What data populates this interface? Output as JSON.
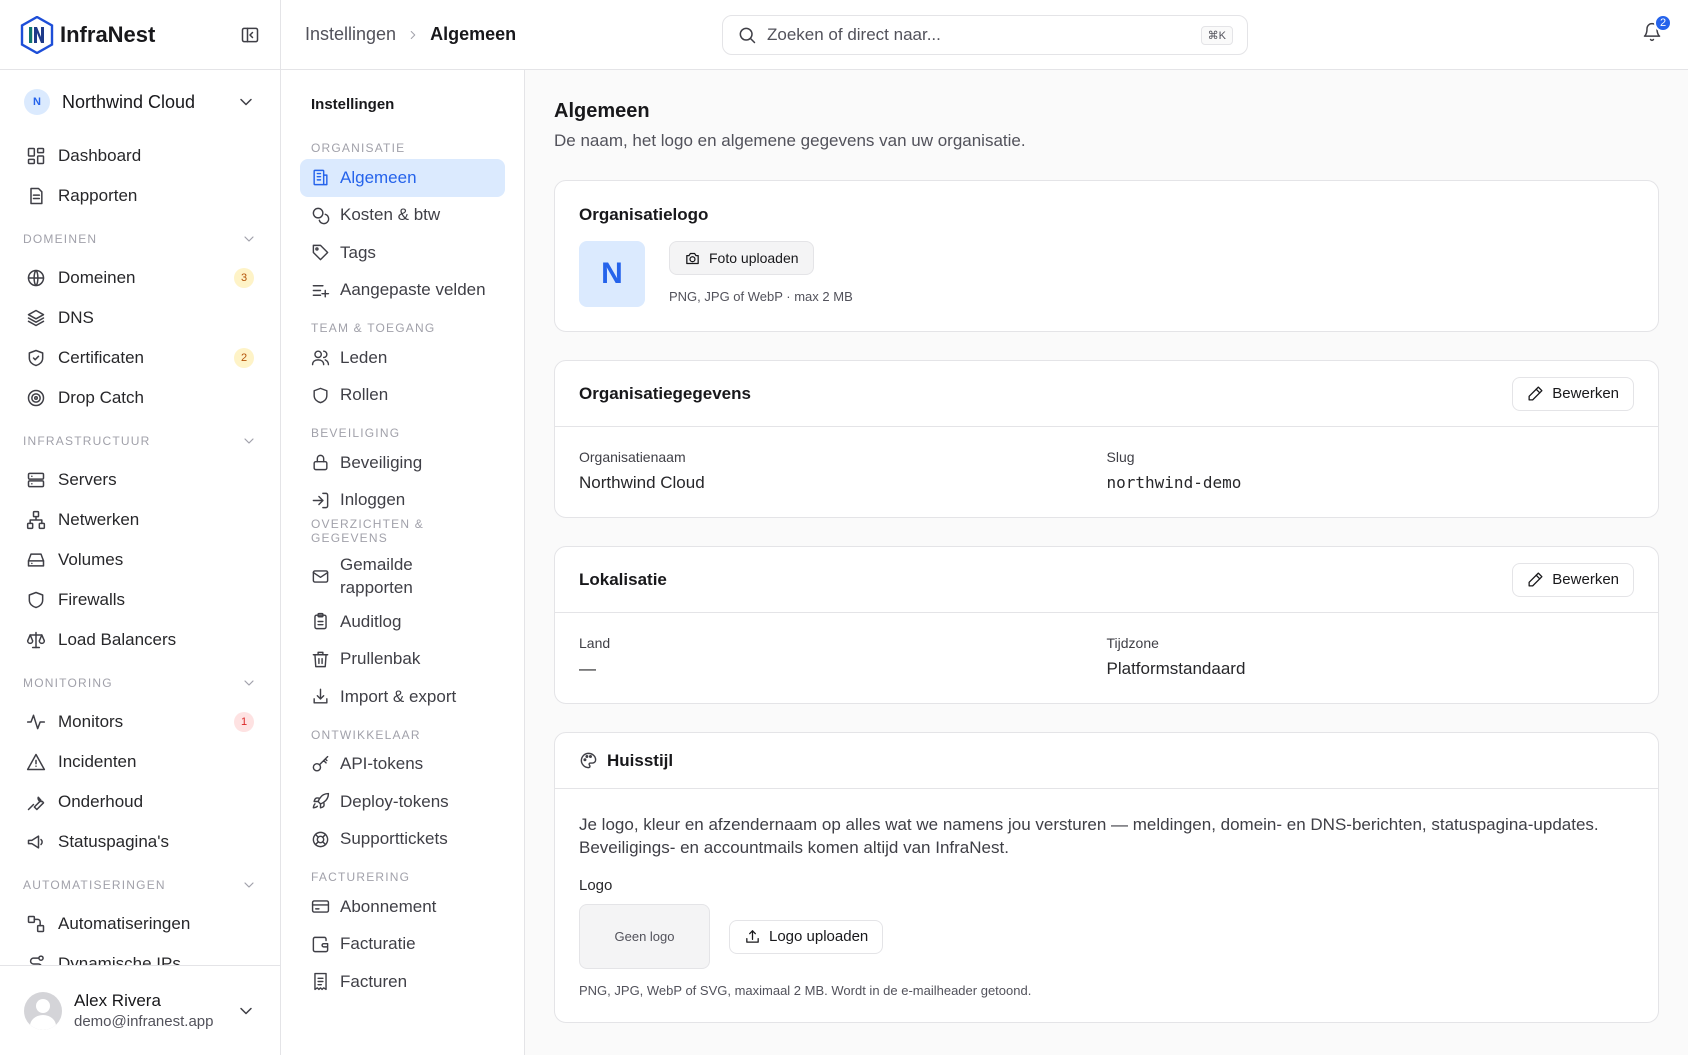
{
  "app": {
    "name": "InfraNest"
  },
  "org": {
    "initial": "N",
    "name": "Northwind Cloud"
  },
  "sidebar": {
    "top": [
      {
        "label": "Dashboard",
        "icon": "dashboard-icon"
      },
      {
        "label": "Rapporten",
        "icon": "report-icon"
      }
    ],
    "sections": [
      {
        "title": "DOMEINEN",
        "items": [
          {
            "label": "Domeinen",
            "icon": "globe-icon",
            "badge": "3",
            "badge_color": "amber"
          },
          {
            "label": "DNS",
            "icon": "layers-icon"
          },
          {
            "label": "Certificaten",
            "icon": "shield-check-icon",
            "badge": "2",
            "badge_color": "amber"
          },
          {
            "label": "Drop Catch",
            "icon": "target-icon"
          }
        ]
      },
      {
        "title": "INFRASTRUCTUUR",
        "items": [
          {
            "label": "Servers",
            "icon": "server-icon"
          },
          {
            "label": "Netwerken",
            "icon": "network-icon"
          },
          {
            "label": "Volumes",
            "icon": "drive-icon"
          },
          {
            "label": "Firewalls",
            "icon": "shield-icon"
          },
          {
            "label": "Load Balancers",
            "icon": "scale-icon"
          }
        ]
      },
      {
        "title": "MONITORING",
        "items": [
          {
            "label": "Monitors",
            "icon": "activity-icon",
            "badge": "1",
            "badge_color": "red"
          },
          {
            "label": "Incidenten",
            "icon": "alert-icon"
          },
          {
            "label": "Onderhoud",
            "icon": "wrench-icon"
          },
          {
            "label": "Statuspagina's",
            "icon": "megaphone-icon"
          }
        ]
      },
      {
        "title": "AUTOMATISERINGEN",
        "items": [
          {
            "label": "Automatiseringen",
            "icon": "workflow-icon"
          },
          {
            "label": "Dynamische IPs",
            "icon": "route-icon"
          }
        ]
      }
    ]
  },
  "user": {
    "name": "Alex Rivera",
    "email": "demo@infranest.app"
  },
  "topbar": {
    "breadcrumb": [
      "Instellingen",
      "Algemeen"
    ],
    "search_placeholder": "Zoeken of direct naar...",
    "shortcut": "⌘K",
    "notifications": "2"
  },
  "subnav": {
    "heading": "Instellingen",
    "sections": [
      {
        "title": "ORGANISATIE",
        "items": [
          {
            "label": "Algemeen",
            "icon": "building-icon",
            "active": true
          },
          {
            "label": "Kosten & btw",
            "icon": "coins-icon"
          },
          {
            "label": "Tags",
            "icon": "tag-icon"
          },
          {
            "label": "Aangepaste velden",
            "icon": "list-plus-icon"
          }
        ]
      },
      {
        "title": "TEAM & TOEGANG",
        "items": [
          {
            "label": "Leden",
            "icon": "users-icon"
          },
          {
            "label": "Rollen",
            "icon": "shield-icon"
          }
        ]
      },
      {
        "title": "BEVEILIGING",
        "items": [
          {
            "label": "Beveiliging",
            "icon": "lock-icon"
          },
          {
            "label": "Inloggen",
            "icon": "login-icon"
          }
        ]
      },
      {
        "title": "OVERZICHTEN & GEGEVENS",
        "items": [
          {
            "label": "Gemailde\nrapporten",
            "icon": "mail-icon"
          },
          {
            "label": "Auditlog",
            "icon": "clipboard-icon"
          },
          {
            "label": "Prullenbak",
            "icon": "trash-icon"
          },
          {
            "label": "Import & export",
            "icon": "download-icon"
          }
        ]
      },
      {
        "title": "ONTWIKKELAAR",
        "items": [
          {
            "label": "API-tokens",
            "icon": "key-icon"
          },
          {
            "label": "Deploy-tokens",
            "icon": "rocket-icon"
          },
          {
            "label": "Supporttickets",
            "icon": "lifebuoy-icon"
          }
        ]
      },
      {
        "title": "FACTURERING",
        "items": [
          {
            "label": "Abonnement",
            "icon": "credit-card-icon"
          },
          {
            "label": "Facturatie",
            "icon": "wallet-icon"
          },
          {
            "label": "Facturen",
            "icon": "receipt-icon"
          }
        ]
      }
    ]
  },
  "main": {
    "title": "Algemeen",
    "subtitle": "De naam, het logo en algemene gegevens van uw organisatie.",
    "logo_card": {
      "title": "Organisatielogo",
      "initial": "N",
      "upload_label": "Foto uploaden",
      "hint": "PNG, JPG of WebP · max 2 MB"
    },
    "details_card": {
      "title": "Organisatiegegevens",
      "edit_label": "Bewerken",
      "name_label": "Organisatienaam",
      "name_value": "Northwind Cloud",
      "slug_label": "Slug",
      "slug_value": "northwind-demo"
    },
    "locale_card": {
      "title": "Lokalisatie",
      "edit_label": "Bewerken",
      "country_label": "Land",
      "country_value": "—",
      "tz_label": "Tijdzone",
      "tz_value": "Platformstandaard"
    },
    "brand_card": {
      "title": "Huisstijl",
      "description": "Je logo, kleur en afzendernaam op alles wat we namens jou versturen — meldingen, domein- en DNS-berichten, statuspagina-updates. Beveiligings- en accountmails komen altijd van InfraNest.",
      "logo_label": "Logo",
      "no_logo": "Geen logo",
      "upload_label": "Logo uploaden",
      "hint": "PNG, JPG, WebP of SVG, maximaal 2 MB. Wordt in de e-mailheader getoond."
    }
  },
  "colors": {
    "accent": "#2563eb",
    "accent_soft": "#dbeafe",
    "border": "#e4e4e7"
  }
}
